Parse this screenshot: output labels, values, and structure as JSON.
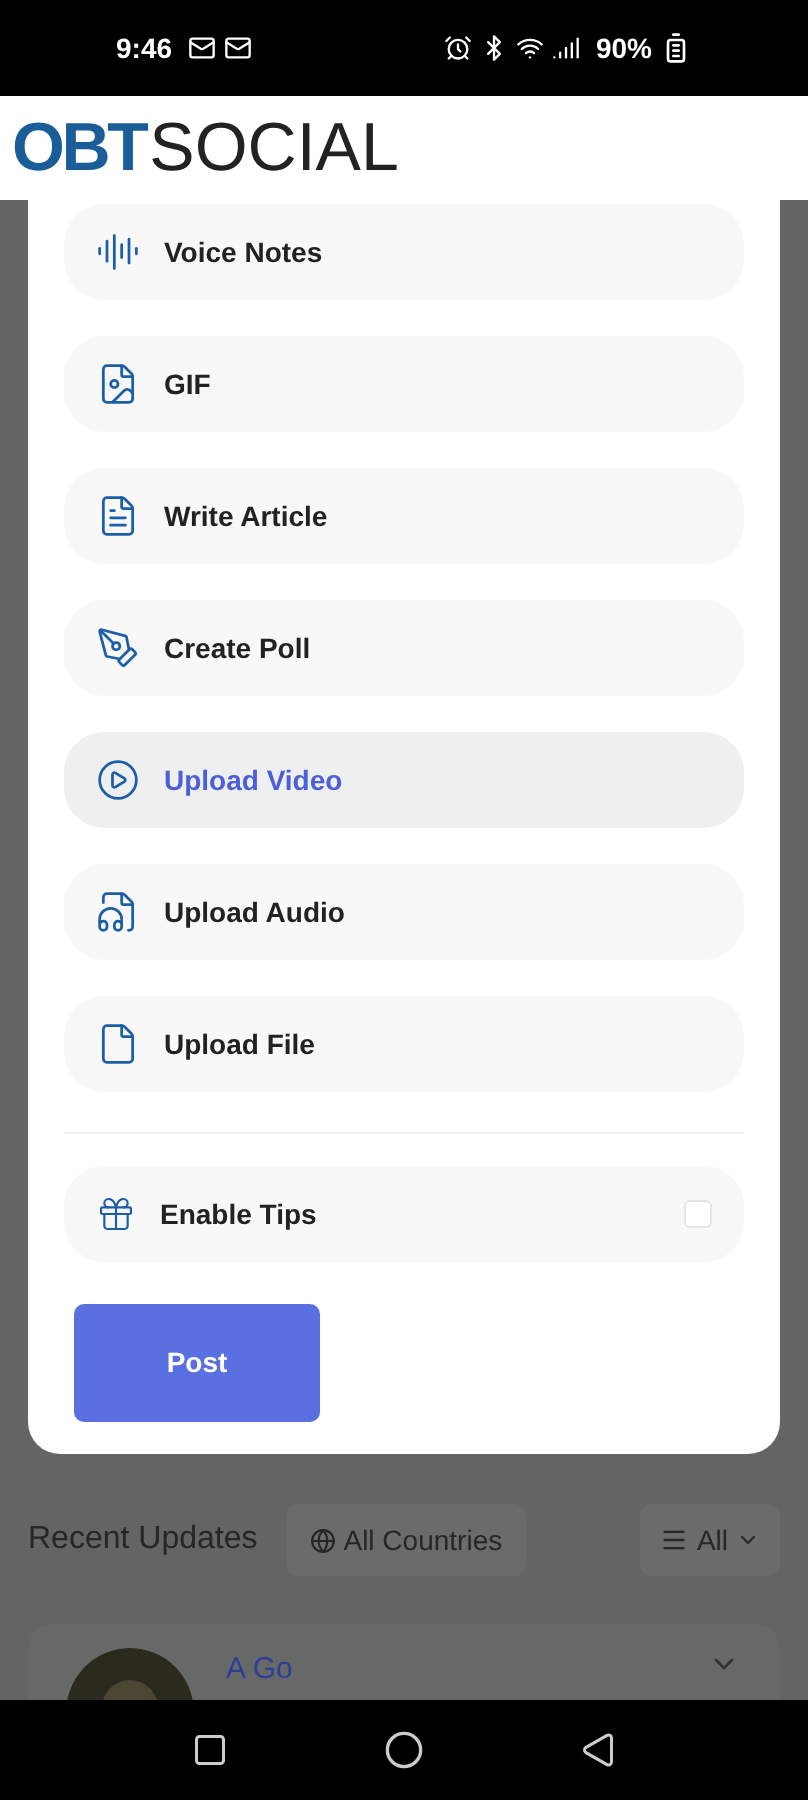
{
  "status_bar": {
    "time": "9:46",
    "battery": "90%"
  },
  "header": {
    "logo_bold": "OBT",
    "logo_light": "SOCIAL"
  },
  "menu": {
    "items": [
      {
        "kind": "voice",
        "label": "Voice Notes",
        "selected": false
      },
      {
        "kind": "gif",
        "label": "GIF",
        "selected": false
      },
      {
        "kind": "article",
        "label": "Write Article",
        "selected": false
      },
      {
        "kind": "poll",
        "label": "Create Poll",
        "selected": false
      },
      {
        "kind": "video",
        "label": "Upload Video",
        "selected": true
      },
      {
        "kind": "audio",
        "label": "Upload Audio",
        "selected": false
      },
      {
        "kind": "file",
        "label": "Upload File",
        "selected": false
      }
    ],
    "tips": {
      "label": "Enable Tips",
      "checked": false
    },
    "post_button": "Post"
  },
  "feed": {
    "title": "Recent Updates",
    "country_filter": "All Countries",
    "type_filter": "All",
    "post": {
      "author": "A Go"
    }
  }
}
